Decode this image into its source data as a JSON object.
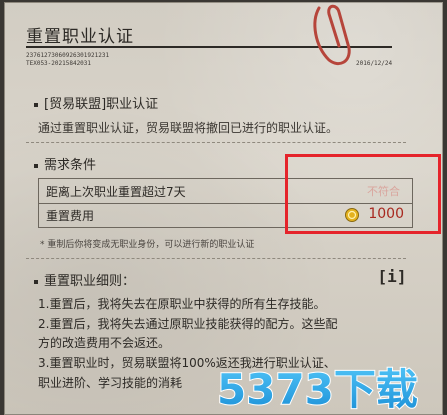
{
  "header": {
    "title": "重置职业认证",
    "code_line1": "23761273060926301921231",
    "code_line2": "TEX053-20215842031",
    "date": "2016/12/24"
  },
  "section1": {
    "heading": "[贸易联盟]职业认证",
    "description": "通过重置职业认证，贸易联盟将撤回已进行的职业认证。"
  },
  "requirements": {
    "heading": "需求条件",
    "rows": [
      {
        "label": "距离上次职业重置超过7天",
        "status": "不符合"
      },
      {
        "label": "重置费用",
        "value": "1000"
      }
    ],
    "note": "* 重制后你将变成无职业身份，可以进行新的职业认证"
  },
  "rules": {
    "heading": "重置职业细则：",
    "info_icon": "[i]",
    "lines": [
      "1.重置后，我将失去在原职业中获得的所有生存技能。",
      "2.重置后，我将失去通过原职业技能获得的配方。这些配",
      "方的改造费用不会返还。",
      "3.重置职业时，贸易联盟将100%返还我进行职业认证、",
      "职业进阶、学习技能的消耗"
    ]
  },
  "watermark": {
    "text": "5373下载",
    "color": "#1fa7e8"
  },
  "colors": {
    "highlight": "#e5242b",
    "cost": "#a8281f",
    "coin": "#e4b21f"
  }
}
